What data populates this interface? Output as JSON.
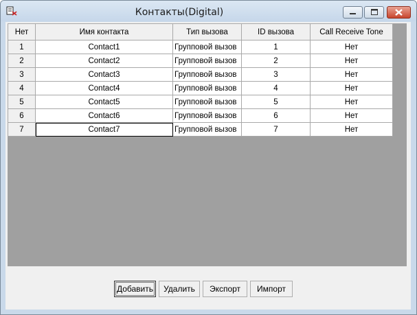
{
  "window": {
    "title": "Контакты(Digital)"
  },
  "grid": {
    "columns": [
      "Нет",
      "Имя контакта",
      "Тип вызова",
      "ID вызова",
      "Call Receive Tone"
    ],
    "rows": [
      [
        "1",
        "Contact1",
        "Групповой вызов",
        "1",
        "Нет"
      ],
      [
        "2",
        "Contact2",
        "Групповой вызов",
        "2",
        "Нет"
      ],
      [
        "3",
        "Contact3",
        "Групповой вызов",
        "3",
        "Нет"
      ],
      [
        "4",
        "Contact4",
        "Групповой вызов",
        "4",
        "Нет"
      ],
      [
        "5",
        "Contact5",
        "Групповой вызов",
        "5",
        "Нет"
      ],
      [
        "6",
        "Contact6",
        "Групповой вызов",
        "6",
        "Нет"
      ],
      [
        "7",
        "Contact7",
        "Групповой вызов",
        "7",
        "Нет"
      ]
    ]
  },
  "buttons": {
    "add": "Добавить",
    "delete": "Удалить",
    "export": "Экспорт",
    "import": "Импорт"
  },
  "icons": {
    "window_icon": "contacts-app-icon",
    "minimize": "minimize-icon",
    "maximize": "maximize-icon",
    "close": "close-icon"
  },
  "colors": {
    "titlebar": "#c9d9ea",
    "grid_background": "#a0a0a0",
    "close_button": "#c8452d"
  }
}
